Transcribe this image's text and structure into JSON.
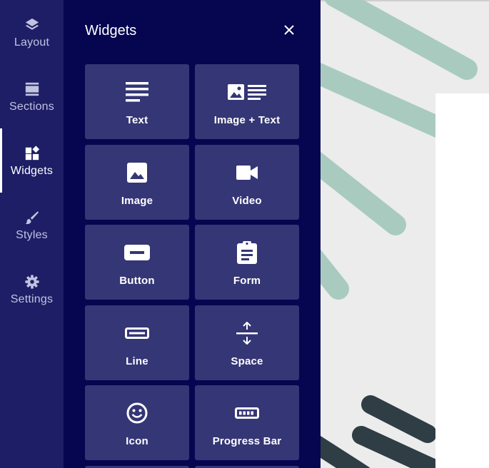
{
  "nav": {
    "items": [
      {
        "label": "Layout",
        "icon": "layers-icon"
      },
      {
        "label": "Sections",
        "icon": "sections-icon"
      },
      {
        "label": "Widgets",
        "icon": "widgets-icon",
        "active": true
      },
      {
        "label": "Styles",
        "icon": "brush-icon"
      },
      {
        "label": "Settings",
        "icon": "gear-icon"
      }
    ]
  },
  "panel": {
    "title": "Widgets",
    "close_icon": "close-icon",
    "tiles": [
      {
        "label": "Text",
        "icon": "text-icon"
      },
      {
        "label": "Image + Text",
        "icon": "image-text-icon"
      },
      {
        "label": "Image",
        "icon": "image-icon"
      },
      {
        "label": "Video",
        "icon": "video-icon"
      },
      {
        "label": "Button",
        "icon": "button-icon"
      },
      {
        "label": "Form",
        "icon": "form-icon"
      },
      {
        "label": "Line",
        "icon": "line-icon"
      },
      {
        "label": "Space",
        "icon": "space-icon"
      },
      {
        "label": "Icon",
        "icon": "smiley-icon"
      },
      {
        "label": "Progress Bar",
        "icon": "progress-bar-icon"
      }
    ]
  },
  "colors": {
    "nav_bg": "#1d1e66",
    "panel_bg": "#060550",
    "tile_bg": "#353675",
    "canvas_bg": "#ececec",
    "stroke_green": "#a9cbbf",
    "stroke_dark": "#2f3d44"
  }
}
